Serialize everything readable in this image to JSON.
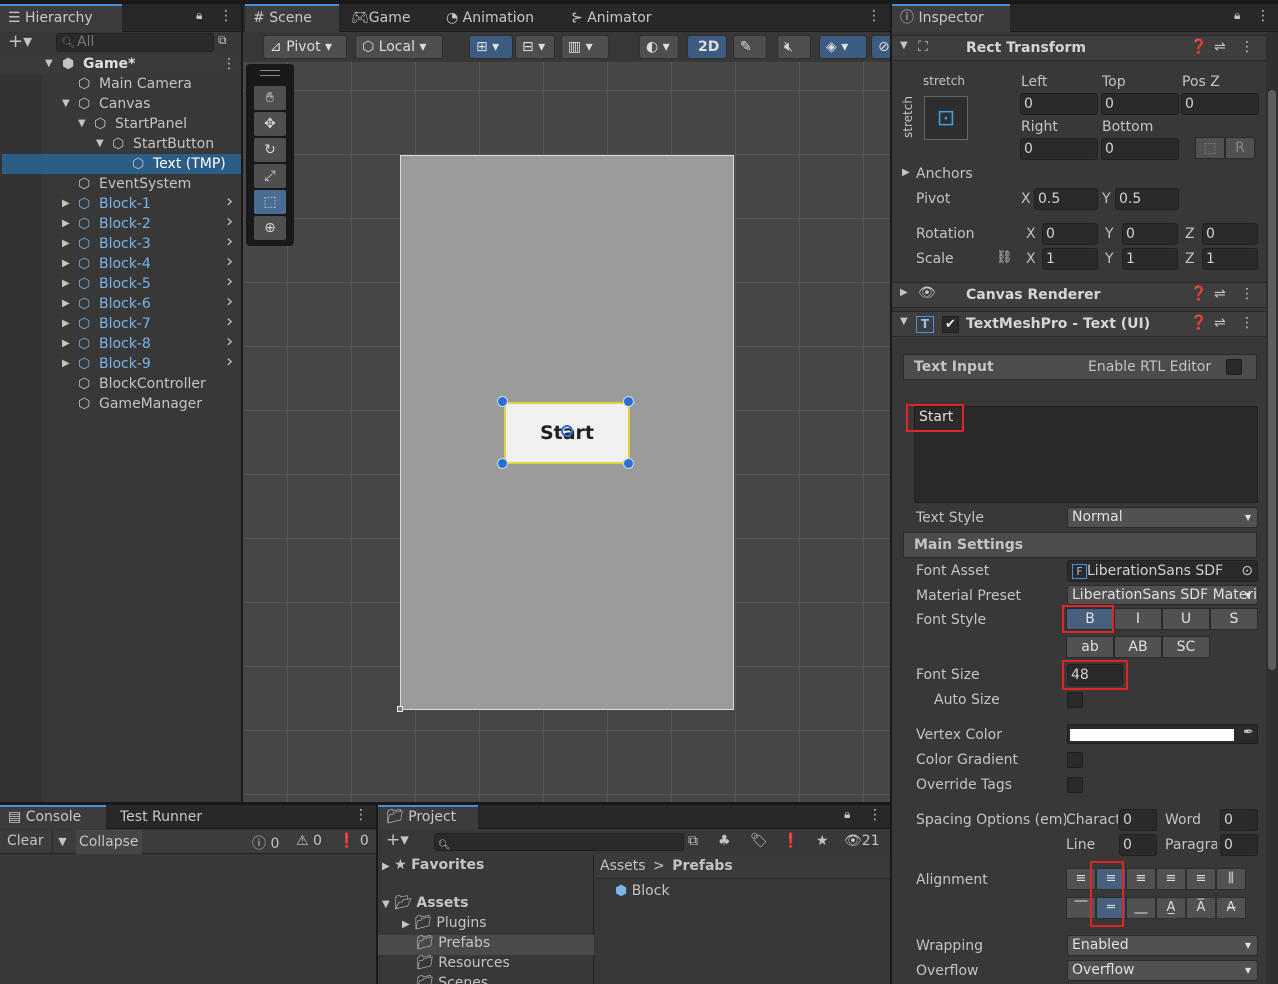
{
  "hierarchy": {
    "tab": "Hierarchy",
    "search_placeholder": "All",
    "scene": "Game*",
    "items": [
      "Main Camera",
      "Canvas",
      "StartPanel",
      "StartButton",
      "Text (TMP)",
      "EventSystem",
      "Block-1",
      "Block-2",
      "Block-3",
      "Block-4",
      "Block-5",
      "Block-6",
      "Block-7",
      "Block-8",
      "Block-9",
      "BlockController",
      "GameManager"
    ]
  },
  "scene_view": {
    "tabs": [
      "Scene",
      "Game",
      "Animation",
      "Animator"
    ],
    "pivot": "Pivot",
    "local": "Local",
    "mode_2d": "2D",
    "button_text": "Start"
  },
  "console": {
    "tabs": [
      "Console",
      "Test Runner"
    ],
    "clear": "Clear",
    "collapse": "Collapse",
    "counts": [
      "0",
      "0",
      "0"
    ]
  },
  "project": {
    "tab": "Project",
    "favorites": "Favorites",
    "assets": "Assets",
    "folders": [
      "Plugins",
      "Prefabs",
      "Resources",
      "Scenes"
    ],
    "breadcrumb_root": "Assets",
    "breadcrumb_sep": ">",
    "breadcrumb_current": "Prefabs",
    "file": "Block",
    "hidden_count": "21"
  },
  "inspector": {
    "tab": "Inspector",
    "rect_transform": {
      "title": "Rect Transform",
      "stretch_h": "stretch",
      "stretch_v": "stretch",
      "labels": {
        "left": "Left",
        "top": "Top",
        "posz": "Pos Z",
        "right": "Right",
        "bottom": "Bottom"
      },
      "values": {
        "left": "0",
        "top": "0",
        "posz": "0",
        "right": "0",
        "bottom": "0"
      },
      "anchors": "Anchors",
      "pivot_label": "Pivot",
      "pivot_x": "0.5",
      "pivot_y": "0.5",
      "rotation_label": "Rotation",
      "rotation": [
        "0",
        "0",
        "0"
      ],
      "scale_label": "Scale",
      "scale": [
        "1",
        "1",
        "1"
      ],
      "axis": [
        "X",
        "Y",
        "Z"
      ]
    },
    "canvas_renderer": "Canvas Renderer",
    "tmp": {
      "title": "TextMeshPro - Text (UI)",
      "text_input": "Text Input",
      "rtl": "Enable RTL Editor",
      "text_value": "Start",
      "text_style_label": "Text Style",
      "text_style": "Normal",
      "main_settings": "Main Settings",
      "font_asset_label": "Font Asset",
      "font_asset": "LiberationSans SDF",
      "material_label": "Material Preset",
      "material": "LiberationSans SDF Material",
      "font_style_label": "Font Style",
      "styles_row1": [
        "B",
        "I",
        "U",
        "S"
      ],
      "styles_row2": [
        "ab",
        "AB",
        "SC"
      ],
      "font_size_label": "Font Size",
      "font_size": "48",
      "auto_size": "Auto Size",
      "vertex_color": "Vertex Color",
      "color_gradient": "Color Gradient",
      "override_tags": "Override Tags",
      "spacing_label": "Spacing Options (em)",
      "spacing": {
        "charac": "Character",
        "charac_val": "0",
        "word": "Word",
        "word_val": "0",
        "line": "Line",
        "line_val": "0",
        "paragr": "Paragraph",
        "paragr_val": "0"
      },
      "alignment": "Alignment",
      "wrapping_label": "Wrapping",
      "wrapping": "Enabled",
      "overflow_label": "Overflow",
      "overflow": "Overflow"
    }
  },
  "colors": {
    "accent": "#4a8fd9",
    "highlight": "#e02525",
    "selection": "#2c5d87",
    "prefab_blue": "#7ab4e8"
  }
}
